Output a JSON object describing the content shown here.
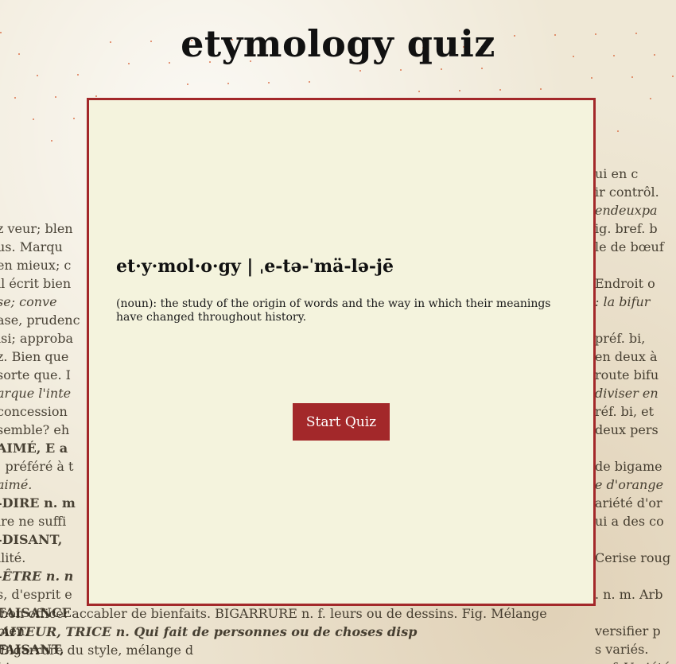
{
  "page": {
    "title": "etymology quiz"
  },
  "card": {
    "headword": "et·y·mol·o·gy  |  ˌe-tə-ˈmä-lə-jē",
    "definition": "(noun): the study of the origin of words and the way in which their meanings have changed throughout history.",
    "start_button_label": "Start Quiz"
  },
  "background_text": {
    "left": [
      "",
      "",
      "",
      "",
      "",
      "",
      "",
      "",
      "",
      "",
      "",
      "",
      "z veur; blen",
      "us. Marqu",
      "en mieux; c",
      "il écrit bien",
      "se; conve",
      "ase, prudenc",
      "isi; approba",
      "z. Bien que",
      "sorte que. I",
      "arque l'inte",
      "concession",
      "semble? eh",
      "AIMÉ, E a",
      "; préféré à t",
      "aimé.",
      "-DIRE n. m",
      "ire ne suffi",
      "-DISANT,",
      "ilité.",
      "-ÊTRE n. n",
      "s, d'esprit e",
      "FAISANCE",
      "bien.",
      "FAISANT,",
      "bien.",
      "FAIT n. m."
    ],
    "right": [
      "",
      "",
      "",
      "",
      "",
      "",
      "",
      "",
      "",
      "ui en c",
      "ir contrôl.",
      "endeuxpa",
      "ig. bref. b",
      "le de bœuf",
      "",
      "Endroit o",
      ": la bifur",
      "",
      "préf. bi,",
      "en deux à",
      "route bifu",
      "diviser en",
      "réf. bi, et",
      "deux pers",
      "",
      "de bigame",
      "e d'orange",
      "ariété d'or",
      "ui a des co",
      "",
      "Cerise roug",
      "",
      ". n. m. Arb",
      "",
      "versifier p",
      "s variés.",
      "n. f. Variété"
    ],
    "bottom": [
      "bon office: accabler de bienfaits.       BIGARRURE n. f.   leurs ou de dessins. Fig. Mélange",
      "AITEUR, TRICE n. Qui fait                de personnes ou de choses disp",
      "                                         Bigarrure du style, mélange d"
    ]
  }
}
